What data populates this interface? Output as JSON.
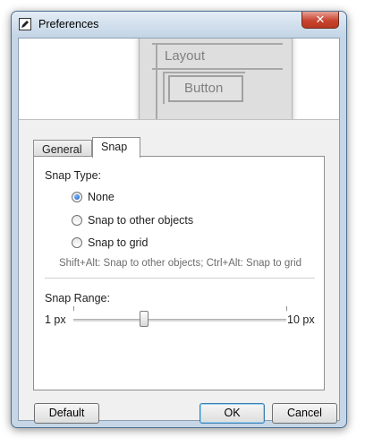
{
  "window": {
    "title": "Preferences",
    "close_label": "✕"
  },
  "preview": {
    "layout_label": "Layout",
    "button_label": "Button"
  },
  "tabs": [
    {
      "label": "General",
      "active": false
    },
    {
      "label": "Snap",
      "active": true
    }
  ],
  "snap": {
    "snap_type_label": "Snap Type:",
    "options": [
      {
        "label": "None",
        "checked": true
      },
      {
        "label": "Snap to other objects",
        "checked": false
      },
      {
        "label": "Snap to grid",
        "checked": false
      }
    ],
    "hint": "Shift+Alt: Snap to other objects; Ctrl+Alt: Snap to grid",
    "range_label": "Snap Range:",
    "range_min": "1 px",
    "range_max": "10 px",
    "range_min_value": 1,
    "range_max_value": 10,
    "range_value": 4
  },
  "buttons": {
    "default": "Default",
    "ok": "OK",
    "cancel": "Cancel"
  },
  "icons": {
    "title": "pencil-icon"
  }
}
